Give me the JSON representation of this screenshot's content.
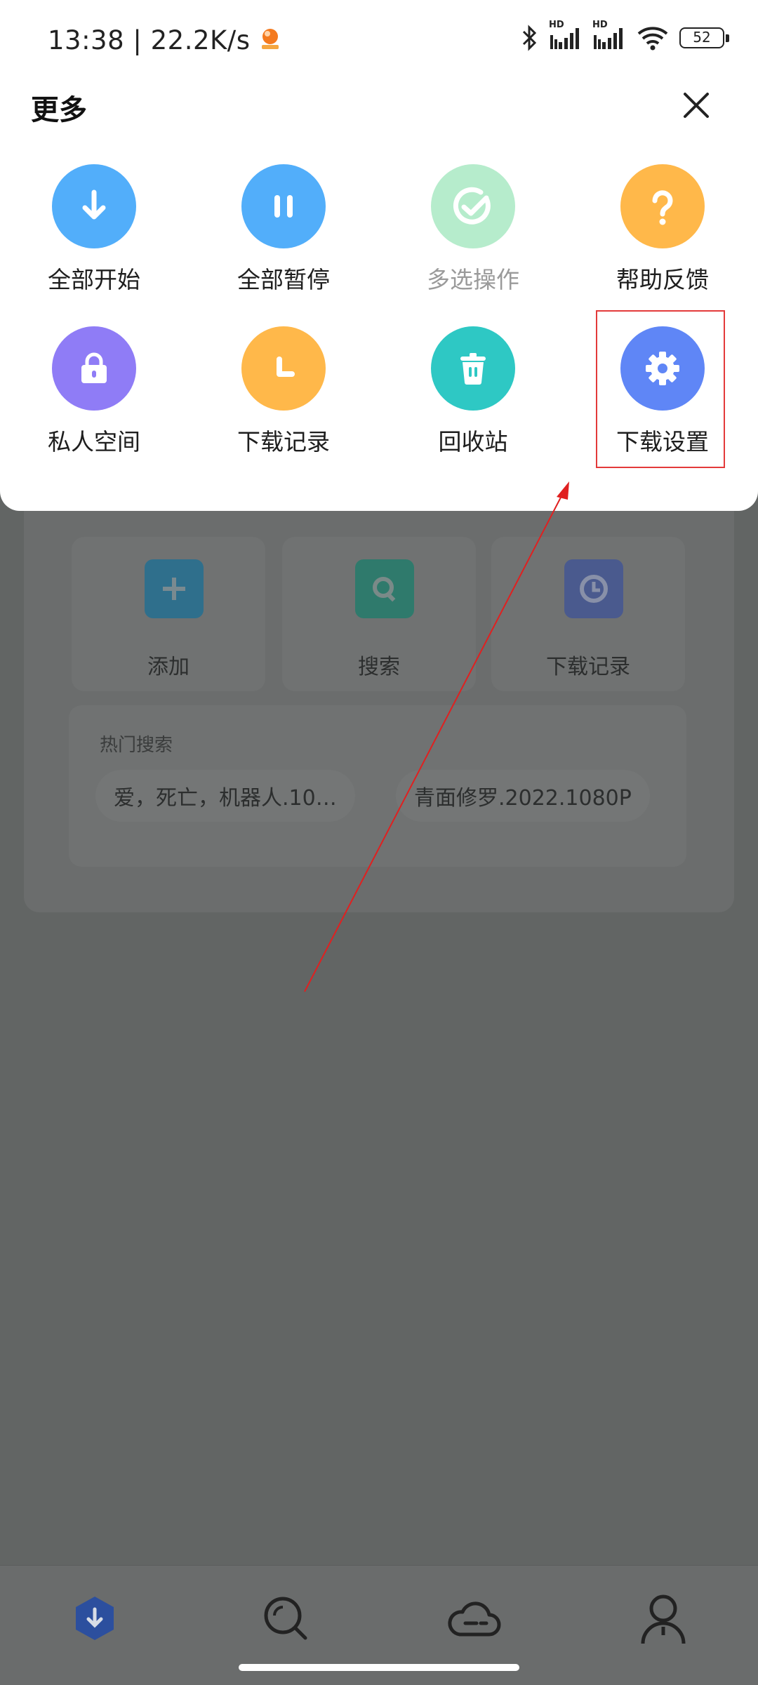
{
  "status_bar": {
    "time": "13:38",
    "speed": "22.2K/s",
    "hd1": "HD",
    "hd2": "HD",
    "battery": "52"
  },
  "sheet": {
    "title": "更多",
    "items": [
      {
        "label": "全部开始",
        "icon": "download-arrow-icon",
        "color": "#52aefa"
      },
      {
        "label": "全部暂停",
        "icon": "pause-icon",
        "color": "#52aefa"
      },
      {
        "label": "多选操作",
        "icon": "check-circle-icon",
        "color": "#b6eccc",
        "disabled": true
      },
      {
        "label": "帮助反馈",
        "icon": "question-icon",
        "color": "#ffb84a"
      },
      {
        "label": "私人空间",
        "icon": "lock-icon",
        "color": "#8f7cf6"
      },
      {
        "label": "下载记录",
        "icon": "history-icon",
        "color": "#ffb84a"
      },
      {
        "label": "回收站",
        "icon": "trash-icon",
        "color": "#2ec8c4"
      },
      {
        "label": "下载设置",
        "icon": "gear-icon",
        "color": "#5f86f6",
        "highlighted": true
      }
    ]
  },
  "background": {
    "quick_actions": [
      {
        "label": "添加",
        "icon": "plus-icon",
        "color": "#2f6f8c"
      },
      {
        "label": "搜索",
        "icon": "search-icon",
        "color": "#2f7a6c"
      },
      {
        "label": "下载记录",
        "icon": "clock-icon",
        "color": "#4a5a8e"
      }
    ],
    "hot_search": {
      "title": "热门搜索",
      "chips": [
        "爱，死亡，机器人.10…",
        "青面修罗.2022.1080P"
      ]
    }
  },
  "bottom_nav": [
    "download-tab-icon",
    "search-tab-icon",
    "cloud-tab-icon",
    "profile-tab-icon"
  ]
}
